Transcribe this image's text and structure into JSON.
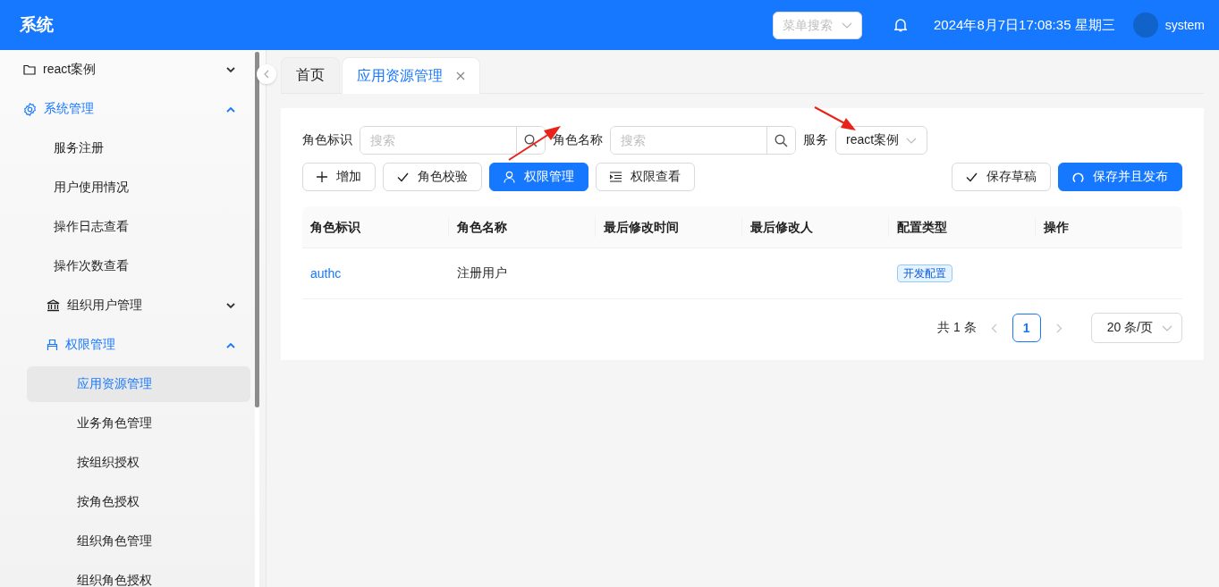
{
  "header": {
    "title": "系统",
    "menu_search": {
      "placeholder": "菜单搜索"
    },
    "datetime": "2024年8月7日17:08:35 星期三",
    "user": "system"
  },
  "sidebar": {
    "items": [
      {
        "label": "react案例",
        "expanded": false,
        "active": false
      },
      {
        "label": "系统管理",
        "expanded": true,
        "active": true,
        "children": [
          {
            "label": "服务注册",
            "selected": false
          },
          {
            "label": "用户使用情况",
            "selected": false
          },
          {
            "label": "操作日志查看",
            "selected": false
          },
          {
            "label": "操作次数查看",
            "selected": false
          },
          {
            "label": "组织用户管理",
            "expanded": false,
            "active": false
          },
          {
            "label": "权限管理",
            "expanded": true,
            "active": true,
            "children": [
              {
                "label": "应用资源管理",
                "selected": true
              },
              {
                "label": "业务角色管理",
                "selected": false
              },
              {
                "label": "按组织授权",
                "selected": false
              },
              {
                "label": "按角色授权",
                "selected": false
              },
              {
                "label": "组织角色管理",
                "selected": false
              },
              {
                "label": "组织角色授权",
                "selected": false
              }
            ]
          }
        ]
      }
    ]
  },
  "tabs": [
    {
      "label": "首页",
      "selected": false,
      "closable": false
    },
    {
      "label": "应用资源管理",
      "selected": true,
      "closable": true
    }
  ],
  "filters": [
    {
      "kind": "search",
      "label": "角色标识",
      "placeholder": "搜索"
    },
    {
      "kind": "search",
      "label": "角色名称",
      "placeholder": "搜索"
    },
    {
      "kind": "select",
      "label": "服务",
      "value": "react案例"
    }
  ],
  "toolbar": {
    "left": [
      {
        "label": "增加",
        "primary": false
      },
      {
        "label": "角色校验",
        "primary": false
      },
      {
        "label": "权限管理",
        "primary": true
      },
      {
        "label": "权限查看",
        "primary": false
      }
    ],
    "right": [
      {
        "label": "保存草稿",
        "primary": false
      },
      {
        "label": "保存并且发布",
        "primary": true
      }
    ]
  },
  "table": {
    "columns": [
      "角色标识",
      "角色名称",
      "最后修改时间",
      "最后修改人",
      "配置类型",
      "操作"
    ],
    "rows": [
      {
        "role_id": "authc",
        "role_name": "注册用户",
        "config_type": "开发配置"
      }
    ]
  },
  "pagination": {
    "total": "共 1 条",
    "prev_disabled": true,
    "next_disabled": true,
    "pages": [
      {
        "label": "1",
        "selected": true
      }
    ],
    "page_size": "20 条/页"
  }
}
